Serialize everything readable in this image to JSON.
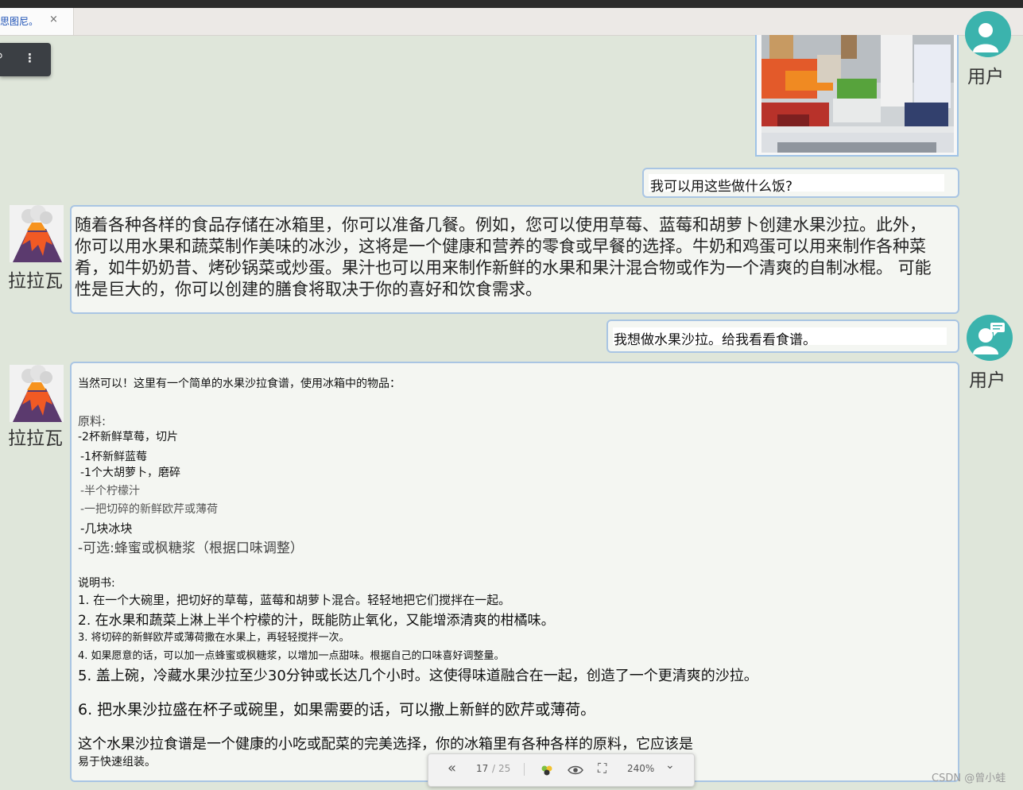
{
  "browser": {
    "tab_title": "思图尼。",
    "tab_close": "×",
    "float_search": "⚲",
    "float_more": "⋮"
  },
  "chat": {
    "user_name": "用户",
    "bot_name": "拉拉瓦",
    "user_msg_1": "我可以用这些做什么饭?",
    "bot_msg_1": "随着各种各样的食品存储在冰箱里，你可以准备几餐。例如，您可以使用草莓、蓝莓和胡萝卜创建水果沙拉。此外，你可以用水果和蔬菜制作美味的冰沙，这将是一个健康和营养的零食或早餐的选择。牛奶和鸡蛋可以用来制作各种菜肴，如牛奶奶昔、烤砂锅菜或炒蛋。果汁也可以用来制作新鲜的水果和果汁混合物或作为一个清爽的自制冰棍。 可能性是巨大的，你可以创建的膳食将取决于你的喜好和饮食需求。",
    "user_msg_2": "我想做水果沙拉。给我看看食谱。",
    "recipe": {
      "intro": "当然可以！这里有一个简单的水果沙拉食谱，使用冰箱中的物品：",
      "ingredients_title": "原料:",
      "ingredients": [
        "-2杯新鲜草莓，切片",
        "-1杯新鲜蓝莓",
        "-1个大胡萝卜，磨碎",
        "-半个柠檬汁",
        "-一把切碎的新鲜欧芹或薄荷",
        "-几块冰块",
        "-可选:蜂蜜或枫糖浆（根据口味调整）"
      ],
      "instructions_title": "说明书:",
      "steps": [
        "1. 在一个大碗里，把切好的草莓，蓝莓和胡萝卜混合。轻轻地把它们搅拌在一起。",
        "2. 在水果和蔬菜上淋上半个柠檬的汁，既能防止氧化，又能增添清爽的柑橘味。",
        "3. 将切碎的新鲜欧芹或薄荷撒在水果上，再轻轻搅拌一次。",
        "4. 如果愿意的话，可以加一点蜂蜜或枫糖浆，以增加一点甜味。根据自己的口味喜好调整量。",
        "5. 盖上碗，冷藏水果沙拉至少30分钟或长达几个小时。这使得味道融合在一起，创造了一个更清爽的沙拉。",
        "6. 把水果沙拉盛在杯子或碗里，如果需要的话，可以撒上新鲜的欧芹或薄荷。"
      ],
      "closing_1": "这个水果沙拉食谱是一个健康的小吃或配菜的完美选择，你的冰箱里有各种各样的原料，它应该是",
      "closing_2": "易于快速组装。"
    }
  },
  "pdf_toolbar": {
    "prev_icon": "«",
    "page_current": "17",
    "page_sep": "/",
    "page_total": "25",
    "zoom": "240%",
    "chevron": "⌄",
    "fullscreen_icon": "⛶"
  },
  "watermark": "CSDN @曾小蛙",
  "colors": {
    "background": "#dfe6da",
    "bubble_border": "#a9c5e3",
    "user_avatar": "#3bb3ad",
    "tab_title": "#1a4fb5"
  }
}
